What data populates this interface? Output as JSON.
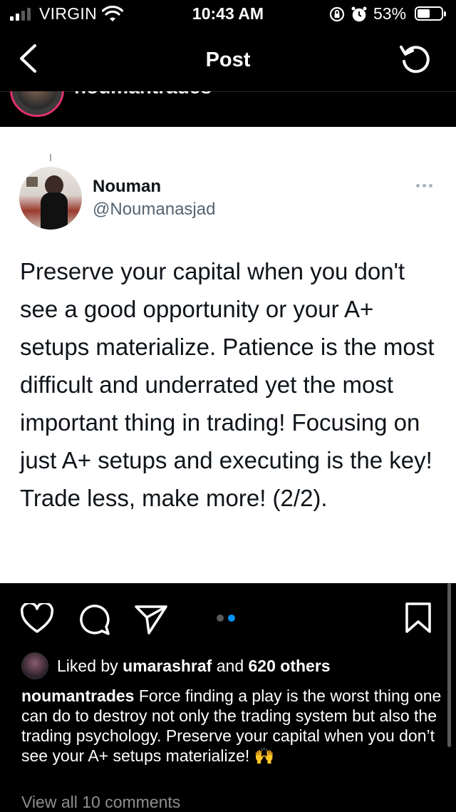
{
  "status_bar": {
    "carrier": "VIRGIN",
    "time": "10:43 AM",
    "battery_percent": "53%",
    "battery_level": 0.53,
    "icons": [
      "signal-icon",
      "wifi-icon",
      "orientation-lock-icon",
      "alarm-icon",
      "battery-icon"
    ]
  },
  "nav": {
    "title": "Post",
    "back_icon": "chevron-left-icon",
    "refresh_icon": "refresh-icon"
  },
  "previous_post": {
    "username": "noumantrades"
  },
  "tweet": {
    "name": "Nouman",
    "handle": "@Noumanasjad",
    "text": "Preserve your capital when you don't see a good opportunity or your A+ setups materialize. Patience is the most difficult and underrated yet the most important thing in trading! Focusing on just A+ setups and executing is the key! Trade less, make more! (2/2)."
  },
  "actions": {
    "icons": [
      "heart-icon",
      "comment-icon",
      "share-icon",
      "bookmark-icon"
    ],
    "carousel": {
      "count": 2,
      "active": 2
    },
    "colors": {
      "active_dot": "#0095f6",
      "inactive_dot": "#5a5a5a"
    }
  },
  "likes": {
    "prefix": "Liked by",
    "user": "umarashraf",
    "connector": "and",
    "others": "620 others"
  },
  "caption": {
    "username": "noumantrades",
    "text": "Force finding a play is the worst thing one can do to destroy not only the trading system but also the trading psychology. Preserve your capital when you don’t see your A+ setups materialize! 🙌"
  },
  "comments": {
    "view_all": "View all 10 comments"
  }
}
